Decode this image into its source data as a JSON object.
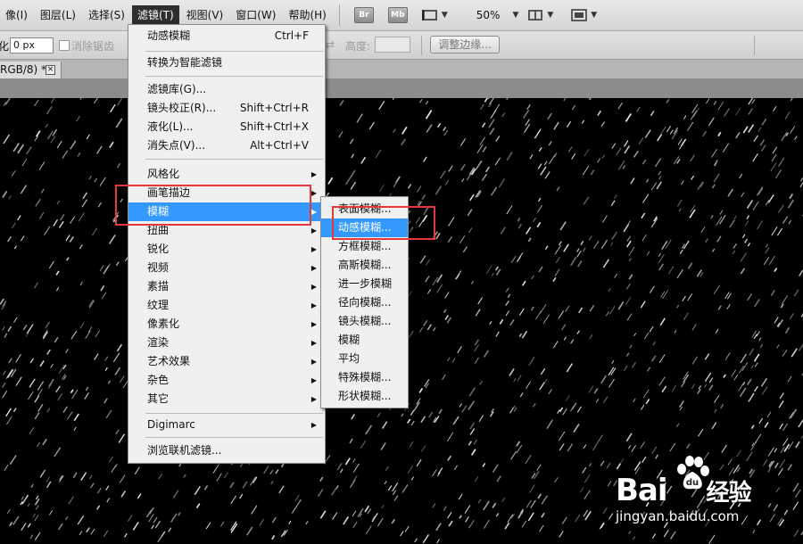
{
  "menubar": {
    "items": [
      "像(I)",
      "图层(L)",
      "选择(S)",
      "滤镜(T)",
      "视图(V)",
      "窗口(W)",
      "帮助(H)"
    ],
    "active_index": 3,
    "bridge_label": "Br",
    "minibridge_label": "Mb",
    "zoom": "50%"
  },
  "options": {
    "feather_prefix": "化:",
    "feather_value": "0 px",
    "antialias_label": "消除锯齿",
    "height_label": "高度:",
    "refine_edge_label": "调整边缘..."
  },
  "document": {
    "tab_title": "RGB/8) *",
    "close_symbol": "×"
  },
  "filter_menu": {
    "top": [
      {
        "label": "动感模糊",
        "shortcut": "Ctrl+F"
      }
    ],
    "convert": "转换为智能滤镜",
    "tools": [
      {
        "label": "滤镜库(G)...",
        "shortcut": ""
      },
      {
        "label": "镜头校正(R)...",
        "shortcut": "Shift+Ctrl+R"
      },
      {
        "label": "液化(L)...",
        "shortcut": "Shift+Ctrl+X"
      },
      {
        "label": "消失点(V)...",
        "shortcut": "Alt+Ctrl+V"
      }
    ],
    "groups": [
      "风格化",
      "画笔描边",
      "模糊",
      "扭曲",
      "锐化",
      "视频",
      "素描",
      "纹理",
      "像素化",
      "渲染",
      "艺术效果",
      "杂色",
      "其它"
    ],
    "highlight_group": 2,
    "digimarc": "Digimarc",
    "browse": "浏览联机滤镜..."
  },
  "blur_submenu": {
    "items": [
      "表面模糊...",
      "动感模糊...",
      "方框模糊...",
      "高斯模糊...",
      "进一步模糊",
      "径向模糊...",
      "镜头模糊...",
      "模糊",
      "平均",
      "特殊模糊...",
      "形状模糊..."
    ],
    "highlight_index": 1
  },
  "watermark": {
    "brand": "Bai",
    "brand2": "经验",
    "url": "jingyan.baidu.com"
  },
  "colors": {
    "highlight": "#3399ff",
    "annotation": "#e5383b",
    "canvas": "#000000"
  }
}
